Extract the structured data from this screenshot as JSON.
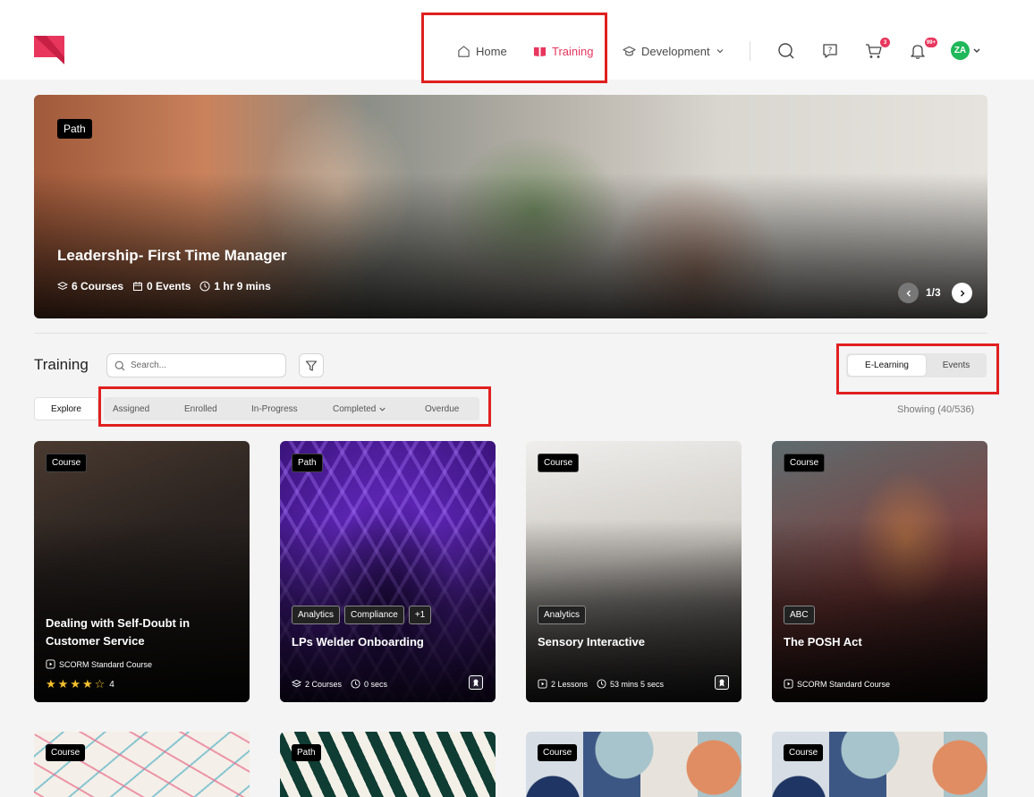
{
  "header": {
    "nav": [
      {
        "label": "Home",
        "icon": "home-icon"
      },
      {
        "label": "Training",
        "icon": "book-icon",
        "active": true,
        "active_color": "#e8365d"
      },
      {
        "label": "Development",
        "icon": "graduation-cap-icon"
      }
    ],
    "cart_badge": "3",
    "notification_badge": "99+",
    "avatar_initials": "ZA",
    "avatar_color": "#1fb85a"
  },
  "hero": {
    "tag": "Path",
    "title": "Leadership- First Time Manager",
    "courses": "6 Courses",
    "events": "0 Events",
    "duration": "1 hr 9 mins",
    "counter": "1/3"
  },
  "training": {
    "title": "Training",
    "search_placeholder": "Search...",
    "view_options": [
      "E-Learning",
      "Events"
    ],
    "active_view": "E-Learning",
    "tabs": [
      "Explore",
      "Assigned",
      "Enrolled",
      "In-Progress",
      "Completed",
      "Overdue"
    ],
    "active_tab": "Explore",
    "showing": "Showing (40/536)"
  },
  "cards": [
    {
      "tag": "Course",
      "title": "Dealing with Self-Doubt in Customer Service",
      "meta": "SCORM Standard Course",
      "rating": "4",
      "stars_filled": 4,
      "stars_total": 5
    },
    {
      "tag": "Path",
      "chips": [
        "Analytics",
        "Compliance",
        "+1"
      ],
      "title": "LPs Welder Onboarding",
      "courses": "2 Courses",
      "duration": "0 secs"
    },
    {
      "tag": "Course",
      "chips": [
        "Analytics"
      ],
      "title": "Sensory Interactive",
      "lessons": "2 Lessons",
      "duration": "53 mins 5 secs"
    },
    {
      "tag": "Course",
      "chips": [
        "ABC"
      ],
      "title": "The POSH Act",
      "meta": "SCORM Standard Course"
    }
  ],
  "cards_row2": [
    {
      "tag": "Course"
    },
    {
      "tag": "Path"
    },
    {
      "tag": "Course"
    },
    {
      "tag": "Course"
    }
  ],
  "annotation_color": "#e0201f"
}
